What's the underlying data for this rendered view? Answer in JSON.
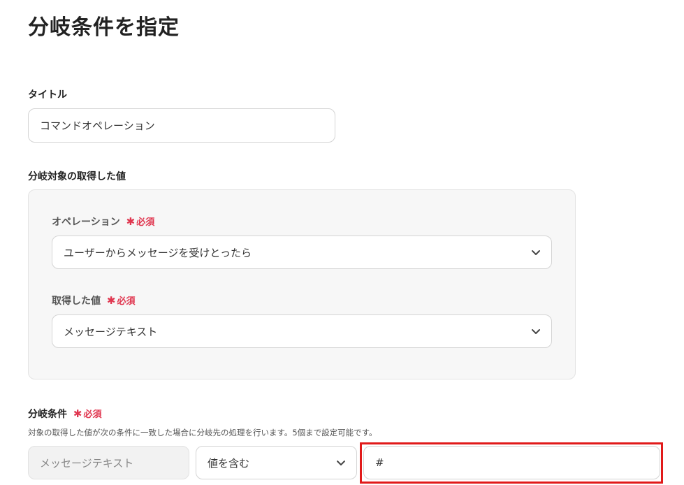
{
  "page": {
    "title": "分岐条件を指定"
  },
  "title_field": {
    "label": "タイトル",
    "value": "コマンドオペレーション"
  },
  "target": {
    "label": "分岐対象の取得した値",
    "operation": {
      "label": "オペレーション",
      "required": "必須",
      "value": "ユーザーからメッセージを受けとったら"
    },
    "value": {
      "label": "取得した値",
      "required": "必須",
      "value": "メッセージテキスト"
    }
  },
  "condition": {
    "label": "分岐条件",
    "required": "必須",
    "help": "対象の取得した値が次の条件に一致した場合に分岐先の処理を行います。5個まで設定可能です。",
    "field_name": "メッセージテキスト",
    "operator": "値を含む",
    "value": "#"
  },
  "colors": {
    "required": "#e0364f",
    "highlight": "#e11a1a",
    "group_bg": "#f7f7f7"
  },
  "icons": {
    "chevron": "chevron-down-icon",
    "asterisk": "asterisk-icon"
  }
}
